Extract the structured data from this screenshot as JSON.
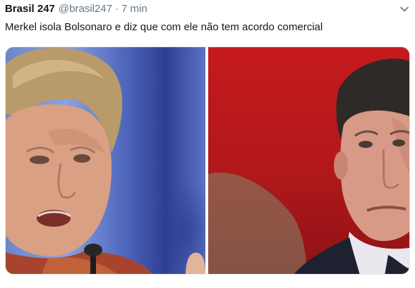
{
  "tweet": {
    "display_name": "Brasil 247",
    "handle": "@brasil247",
    "separator": "·",
    "timestamp": "7 min",
    "text": "Merkel isola Bolsonaro e diz que com ele não tem acordo comercial",
    "icons": {
      "caret": "chevron-down-icon"
    },
    "media": [
      {
        "subject": "Angela Merkel",
        "background": "blue"
      },
      {
        "subject": "Jair Bolsonaro",
        "background": "red"
      }
    ]
  },
  "colors": {
    "name_text": "#14171a",
    "secondary_text": "#657786",
    "body_text": "#14171a"
  }
}
